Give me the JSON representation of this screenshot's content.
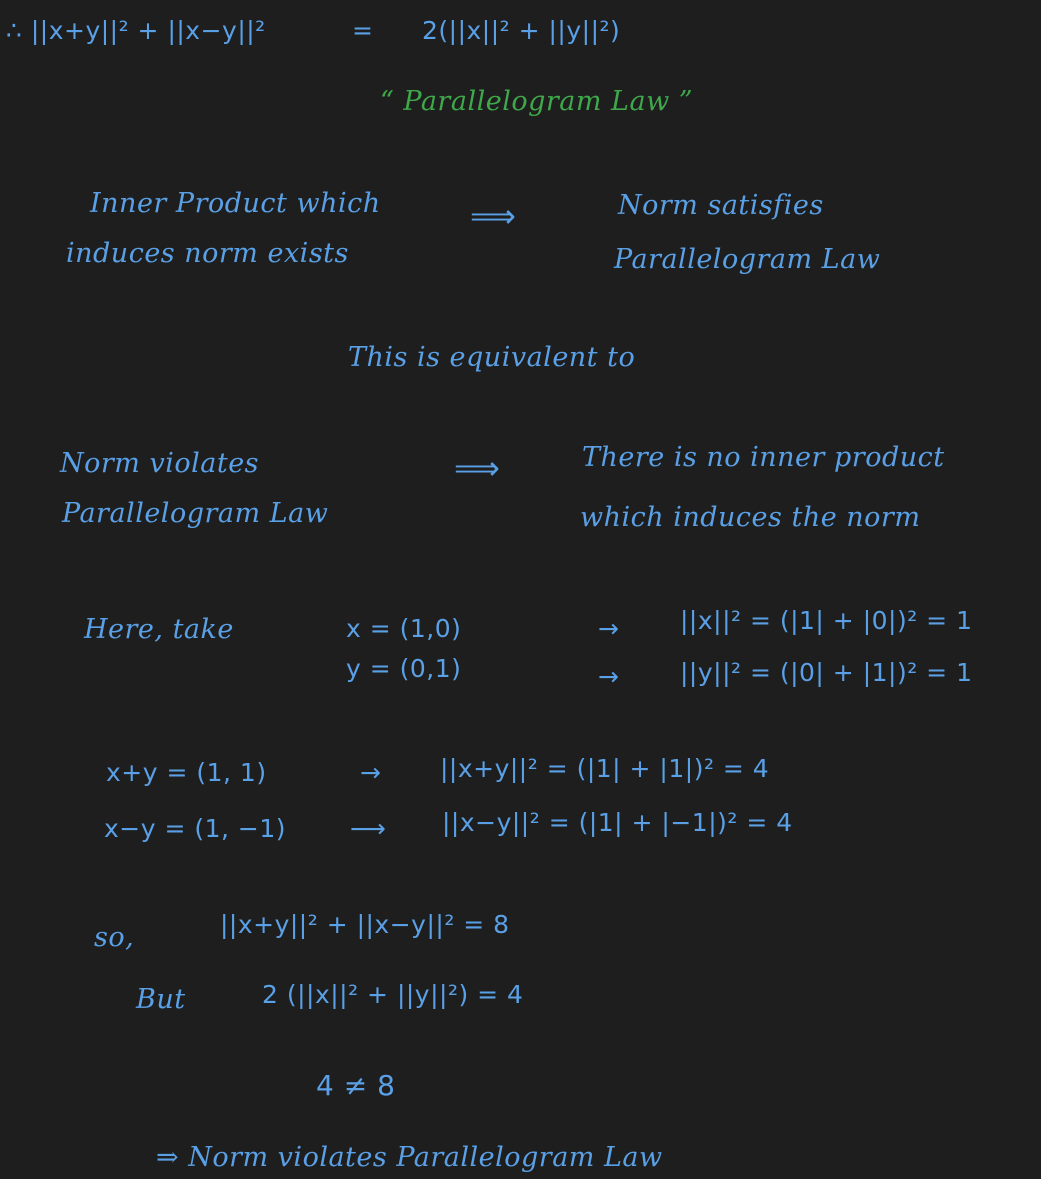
{
  "colors": {
    "background": "#1e1e1e",
    "ink_blue": "#5aa0e6",
    "ink_green": "#3ea84a"
  },
  "header": {
    "identity_lhs": "∴ ||x+y||² + ||x−y||²",
    "identity_eq": "=",
    "identity_rhs": "2(||x||² + ||y||²)",
    "law_name": "“ Parallelogram Law ”"
  },
  "implication": {
    "left_line1": "Inner Product which",
    "left_line2": "induces norm exists",
    "arrow": "⟹",
    "right_line1": "Norm satisfies",
    "right_line2": "Parallelogram Law"
  },
  "equivalence": {
    "text": "This is equivalent to"
  },
  "contrapositive": {
    "left_line1": "Norm violates",
    "left_line2": "Parallelogram Law",
    "arrow": "⟹",
    "right_line1": "There is no inner product",
    "right_line2": "which induces the norm"
  },
  "example": {
    "here_take": "Here, take",
    "x_def": "x = (1,0)",
    "y_def": "y = (0,1)",
    "arrow_x": "→",
    "arrow_y": "→",
    "x_norm": "||x||² = (|1| + |0|)² = 1",
    "y_norm": "||y||² = (|0| + |1|)² = 1",
    "sum_def": "x+y = (1, 1)",
    "diff_def": "x−y = (1, −1)",
    "arrow_sum": "→",
    "arrow_diff": "⟶",
    "sum_norm": "||x+y||² = (|1| + |1|)² = 4",
    "diff_norm": "||x−y||² = (|1| + |−1|)² = 4"
  },
  "conclusion": {
    "so": "so,",
    "lhs": "||x+y||² + ||x−y||² = 8",
    "but": "But",
    "rhs": "2 (||x||² + ||y||²) = 4",
    "neq": "4 ≠ 8",
    "final": "⇒ Norm violates Parallelogram Law"
  }
}
